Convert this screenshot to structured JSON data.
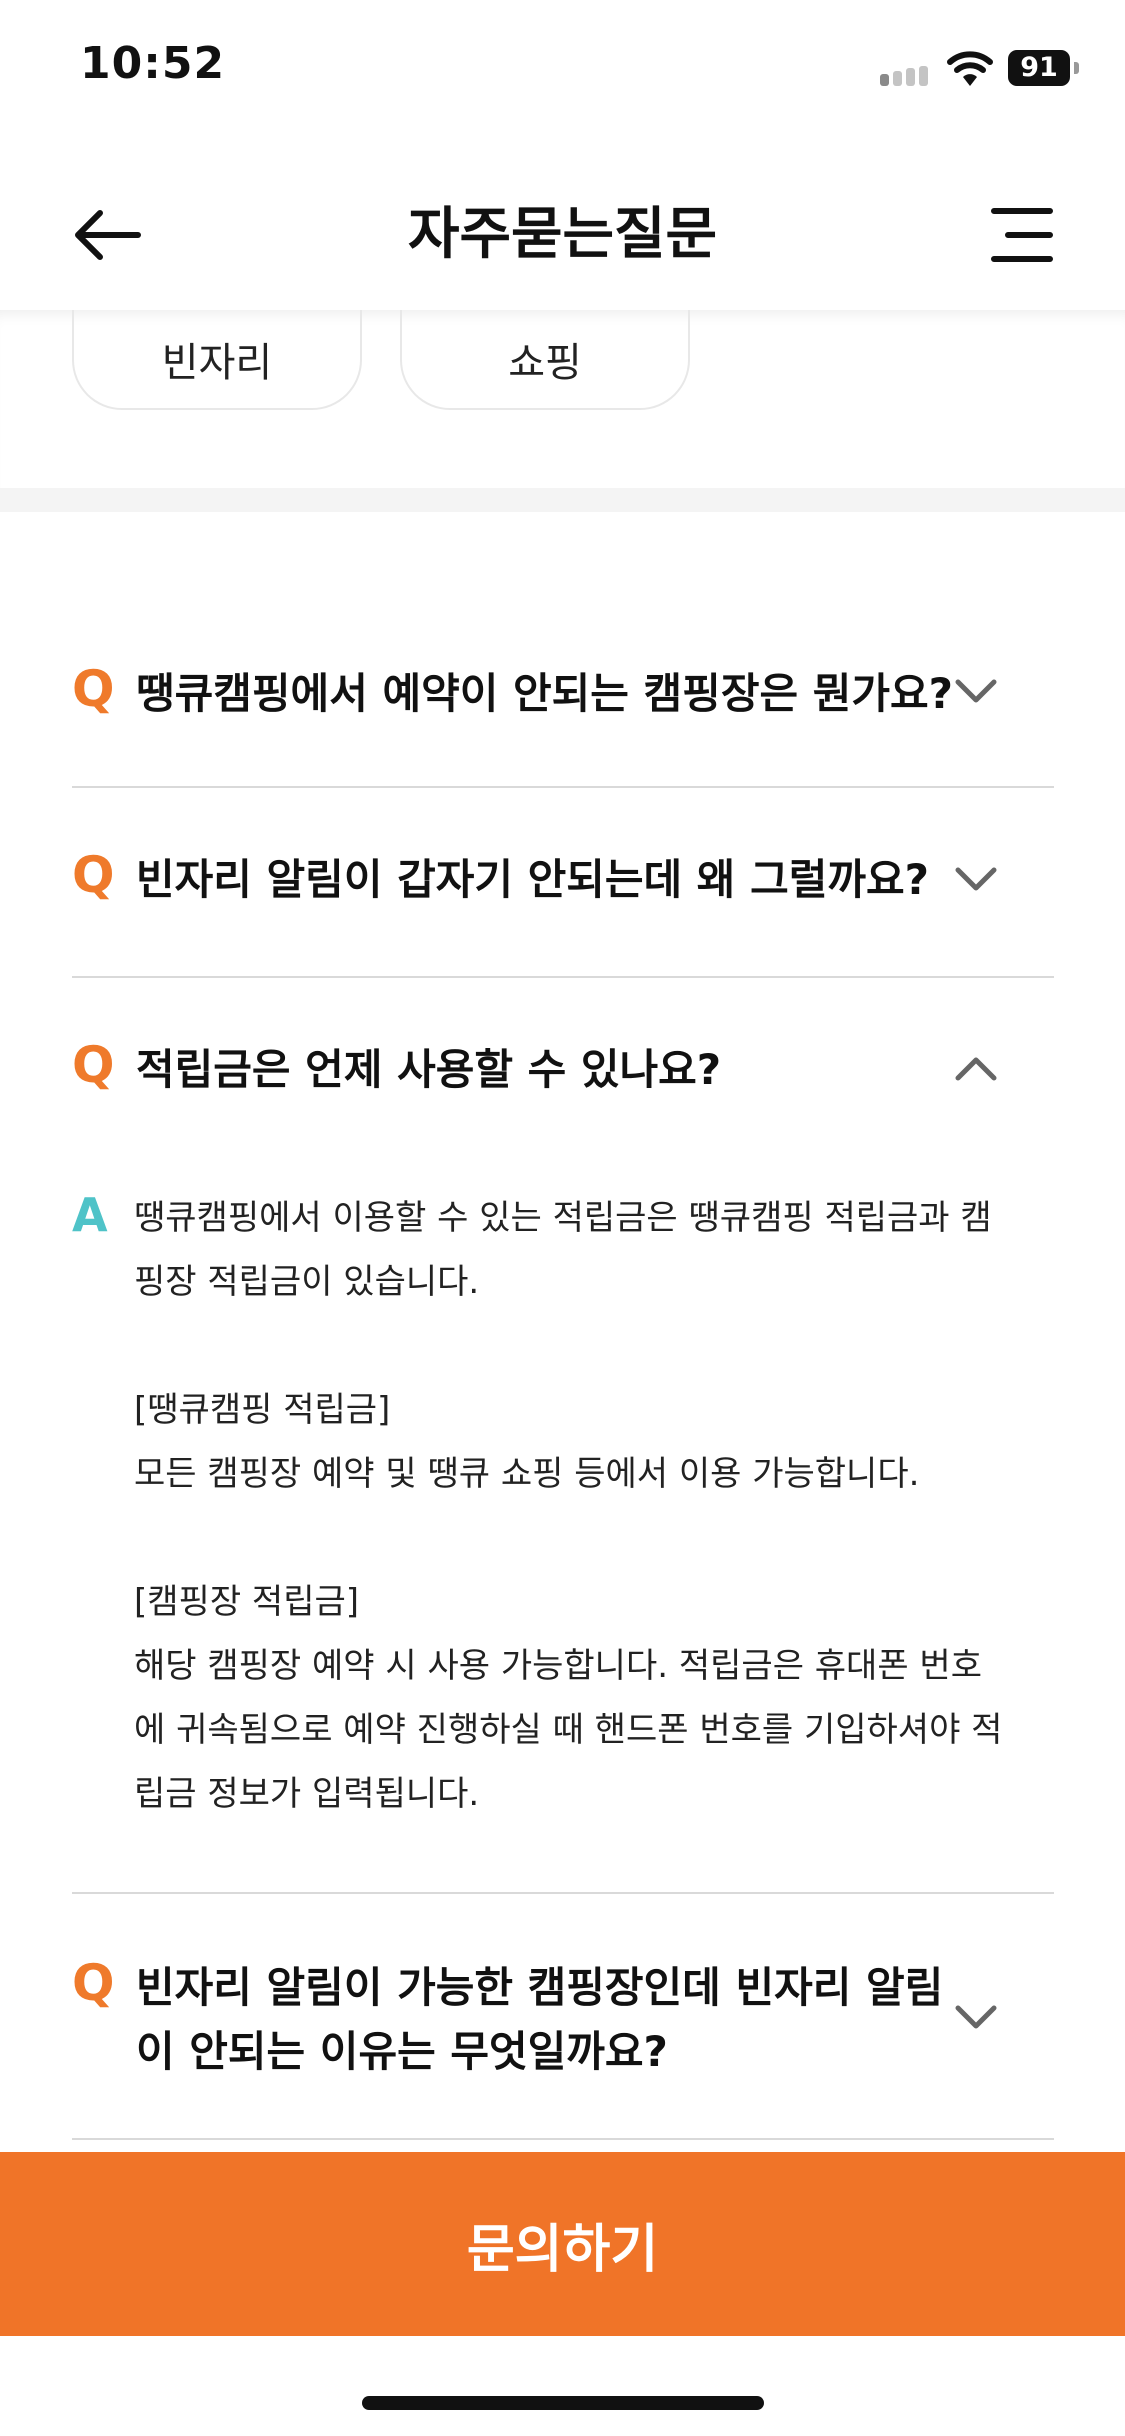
{
  "status_bar": {
    "time": "10:52",
    "battery": "91"
  },
  "header": {
    "title": "자주묻는질문"
  },
  "chips": [
    {
      "label": "빈자리"
    },
    {
      "label": "쇼핑"
    }
  ],
  "faqs": [
    {
      "question": "땡큐캠핑에서 예약이 안되는 캠핑장은 뭔가요?",
      "expanded": false
    },
    {
      "question": "빈자리 알림이 갑자기 안되는데 왜 그럴까요?",
      "expanded": false
    },
    {
      "question": "적립금은 언제 사용할 수 있나요?",
      "expanded": true,
      "answer": "땡큐캠핑에서 이용할 수 있는 적립금은 땡큐캠핑 적립금과 캠\n핑장 적립금이 있습니다.\n\n[땡큐캠핑 적립금]\n모든 캠핑장 예약 및 땡큐 쇼핑 등에서 이용 가능합니다.\n\n[캠핑장 적립금]\n해당 캠핑장 예약 시 사용 가능합니다. 적립금은 휴대폰 번호\n에 귀속됨으로 예약 진행하실 때 핸드폰 번호를 기입하셔야 적\n립금 정보가 입력됩니다."
    },
    {
      "question": "빈자리 알림이 가능한 캠핑장인데 빈자리 알림\n이 안되는 이유는 무엇일까요?",
      "expanded": false
    }
  ],
  "labels": {
    "q_mark": "Q",
    "a_mark": "A"
  },
  "bottom_button": {
    "label": "문의하기"
  },
  "colors": {
    "accent": "#f07428",
    "q_mark": "#ef7a2b",
    "a_mark": "#4fc3c8"
  }
}
